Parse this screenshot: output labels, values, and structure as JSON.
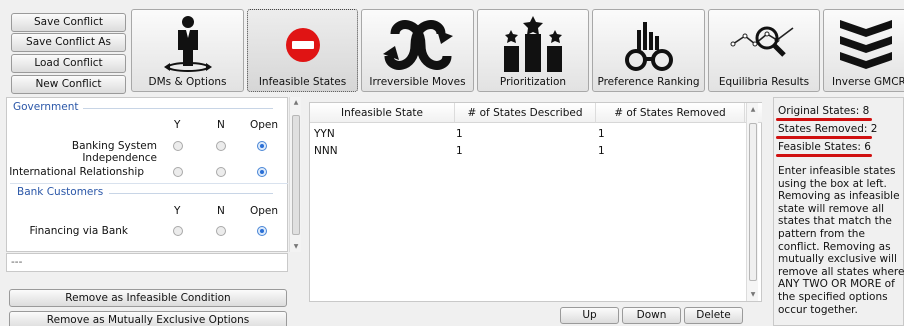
{
  "file_menu": {
    "save": "Save Conflict",
    "save_as": "Save Conflict As",
    "load": "Load Conflict",
    "new": "New Conflict"
  },
  "toolbar": {
    "dms_options": "DMs & Options",
    "infeasible_states": "Infeasible States",
    "irreversible_moves": "Irreversible Moves",
    "prioritization": "Prioritization",
    "preference_ranking": "Preference Ranking",
    "equilibria_results": "Equilibria Results",
    "inverse_gmcr": "Inverse GMCR"
  },
  "options_panel": {
    "col_y": "Y",
    "col_n": "N",
    "col_open": "Open",
    "groups": [
      {
        "name": "Government",
        "options": [
          {
            "label": "Banking System Independence",
            "selected": "Open"
          },
          {
            "label": "International Relationship",
            "selected": "Open"
          }
        ]
      },
      {
        "name": "Bank Customers",
        "options": [
          {
            "label": "Financing via Bank",
            "selected": "Open"
          }
        ]
      }
    ]
  },
  "pattern_field": {
    "value": "---"
  },
  "actions": {
    "remove_infeasible": "Remove as Infeasible Condition",
    "remove_exclusive": "Remove as Mutually Exclusive Options"
  },
  "infeasible_table": {
    "headers": [
      "Infeasible State",
      "# of States Described",
      "# of States Removed"
    ],
    "rows": [
      [
        "YYN",
        "1",
        "1"
      ],
      [
        "NNN",
        "1",
        "1"
      ]
    ]
  },
  "table_buttons": {
    "up": "Up",
    "down": "Down",
    "delete": "Delete"
  },
  "summary": {
    "original": "Original States: 8",
    "removed": "States Removed: 2",
    "feasible": "Feasible States: 6",
    "highlight_color": "#d01010"
  },
  "help_text": "Enter infeasible states using the box at left. Removing as infeasible state will remove all states that match the pattern from the conflict. Removing as mutually exclusive will remove all states where ANY TWO OR MORE of the specified options occur together."
}
